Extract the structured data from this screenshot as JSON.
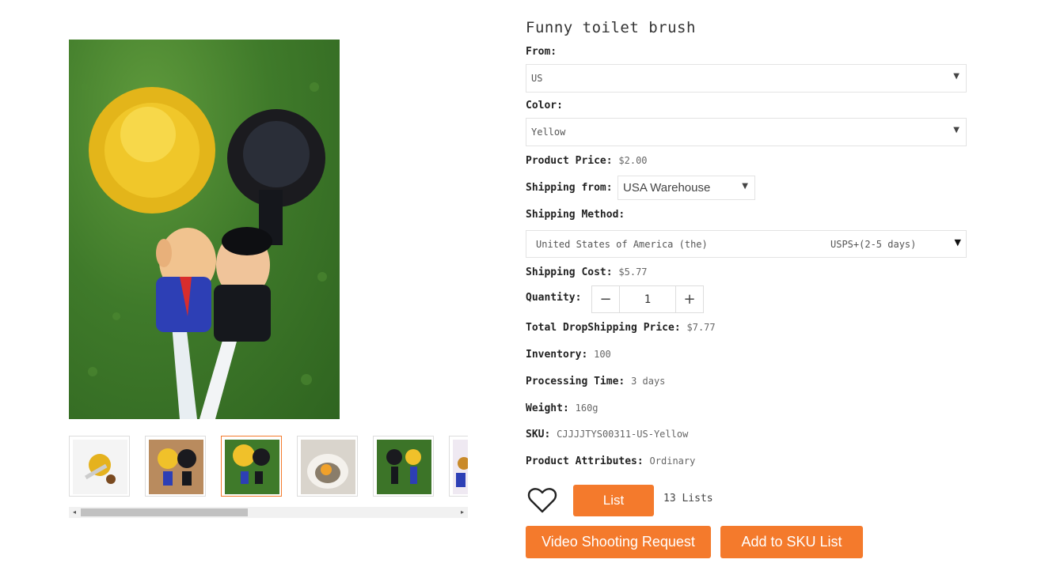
{
  "product": {
    "title": "Funny toilet brush"
  },
  "from": {
    "label": "From:",
    "value": "US"
  },
  "color": {
    "label": "Color:",
    "value": "Yellow"
  },
  "price": {
    "label": "Product Price:",
    "value": "$2.00"
  },
  "shipping_from": {
    "label": "Shipping from:",
    "value": "USA Warehouse"
  },
  "shipping_method": {
    "label": "Shipping Method:",
    "country": "United States of America (the)",
    "service": "USPS+(2-5 days)"
  },
  "shipping_cost": {
    "label": "Shipping Cost:",
    "value": "$5.77"
  },
  "quantity": {
    "label": "Quantity:",
    "value": "1",
    "minus": "−",
    "plus": "+"
  },
  "total": {
    "label": "Total DropShipping Price:",
    "value": "$7.77"
  },
  "inventory": {
    "label": "Inventory:",
    "value": "100"
  },
  "processing": {
    "label": "Processing Time:",
    "value": "3 days"
  },
  "weight": {
    "label": "Weight:",
    "value": "160g"
  },
  "sku": {
    "label": "SKU:",
    "value": "CJJJJTYS00311-US-Yellow"
  },
  "attributes": {
    "label": "Product Attributes:",
    "value": "Ordinary"
  },
  "actions": {
    "list_label": "List",
    "lists_count": "13 Lists",
    "video_label": "Video Shooting Request",
    "sku_label": "Add to SKU List"
  },
  "icons": {
    "caret": "▼",
    "scroll_left": "◂",
    "scroll_right": "▸",
    "heart": "heart-icon"
  },
  "gallery": {
    "thumbnail_count": 6,
    "active_index": 2
  },
  "colors": {
    "accent": "#f47a2c",
    "active_border": "#f47a2c"
  }
}
